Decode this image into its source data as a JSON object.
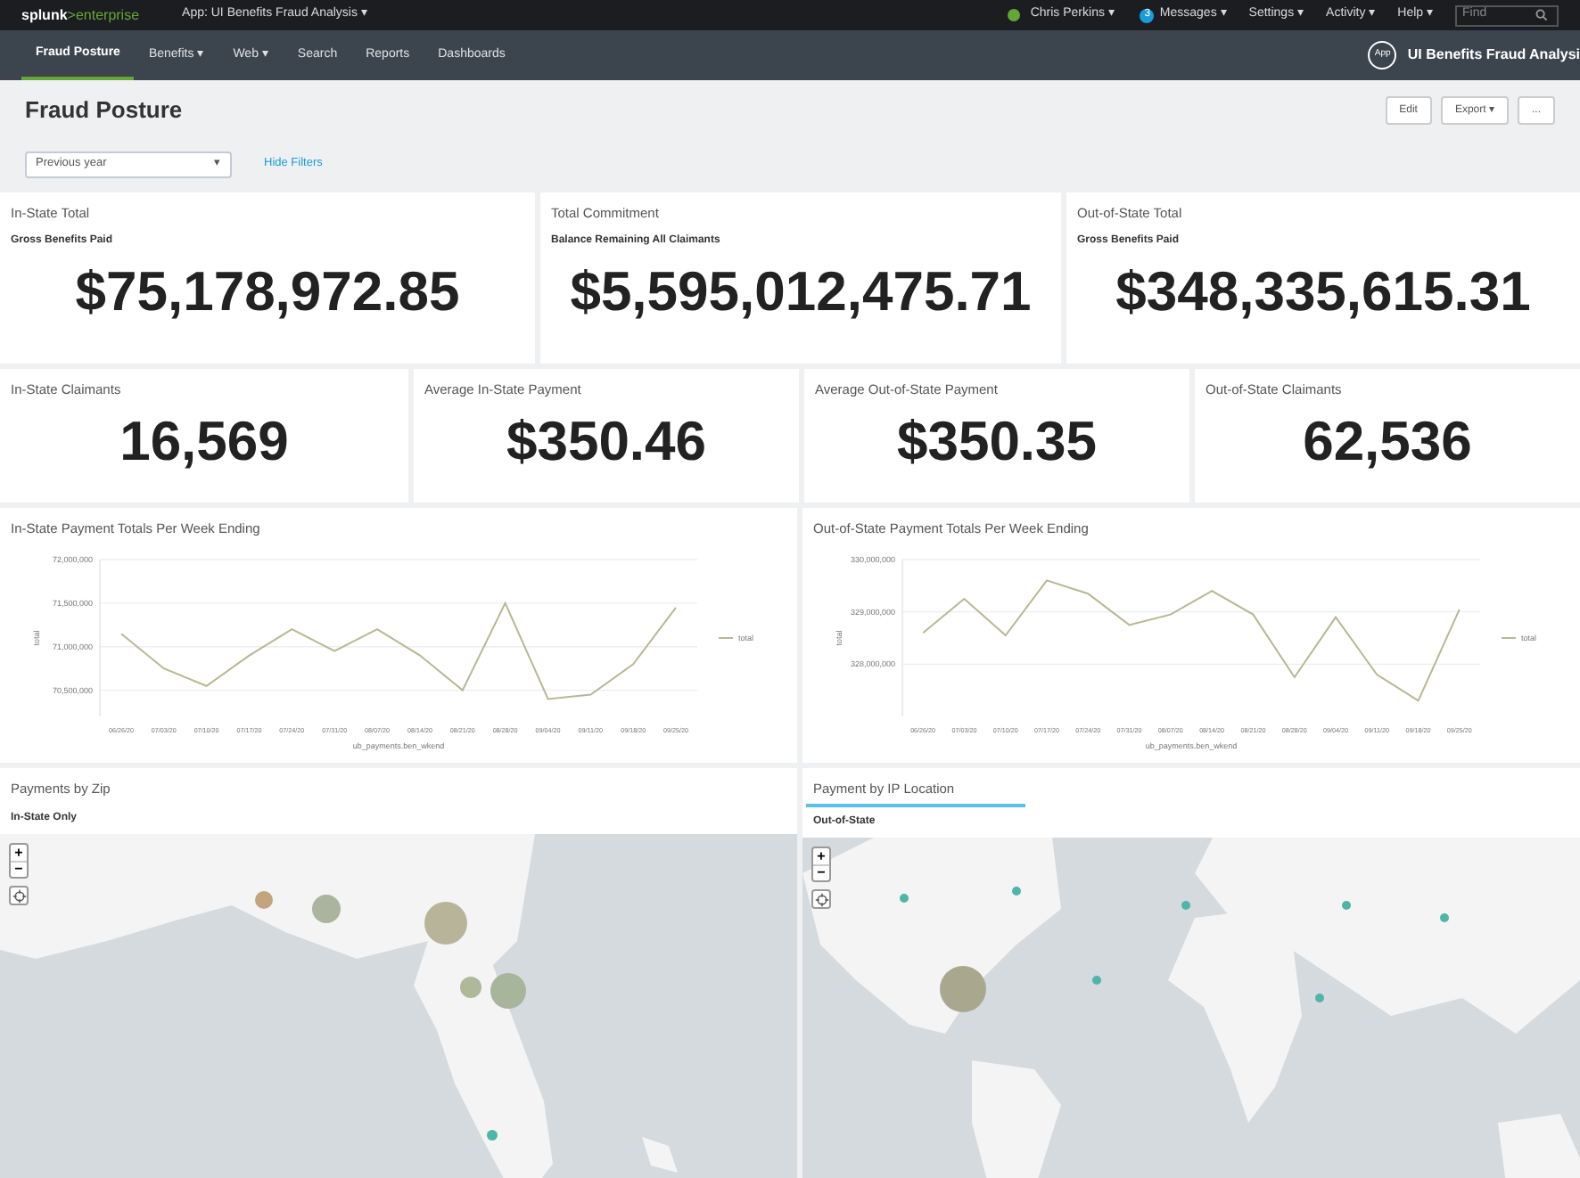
{
  "top_bar": {
    "logo": {
      "main": "splunk",
      "accent": ">enterprise"
    },
    "app_menu": "App: UI Benefits Fraud Analysis ▾",
    "user": "Chris Perkins ▾",
    "messages": {
      "count": "3",
      "label": "Messages ▾"
    },
    "menus": [
      "Settings ▾",
      "Activity ▾",
      "Help ▾"
    ],
    "find": {
      "placeholder": "Find"
    }
  },
  "nav": {
    "items": [
      {
        "label": "Fraud Posture",
        "selected": true
      },
      {
        "label": "Benefits ▾",
        "selected": false
      },
      {
        "label": "Web ▾",
        "selected": false
      },
      {
        "label": "Search",
        "selected": false
      },
      {
        "label": "Reports",
        "selected": false
      },
      {
        "label": "Dashboards",
        "selected": false
      }
    ],
    "app_badge": "App",
    "app_title": "UI Benefits Fraud Analysi"
  },
  "page": {
    "title": "Fraud Posture",
    "buttons": [
      "Edit",
      "Export ▾",
      "..."
    ]
  },
  "filters": {
    "time": {
      "value": "Previous year",
      "caret": "▾"
    },
    "hide_link": "Hide Filters"
  },
  "totals": [
    {
      "title": "In-State Total",
      "subtitle": "Gross Benefits Paid",
      "value": "$75,178,972.85"
    },
    {
      "title": "Total Commitment",
      "subtitle": "Balance Remaining All Claimants",
      "value": "$5,595,012,475.71"
    },
    {
      "title": "Out-of-State Total",
      "subtitle": "Gross Benefits Paid",
      "value": "$348,335,615.31"
    }
  ],
  "metrics": [
    {
      "title": "In-State Claimants",
      "value": "16,569"
    },
    {
      "title": "Average In-State Payment",
      "value": "$350.46"
    },
    {
      "title": "Average Out-of-State Payment",
      "value": "$350.35"
    },
    {
      "title": "Out-of-State Claimants",
      "value": "62,536"
    }
  ],
  "charts": [
    {
      "title": "In-State Payment Totals Per Week Ending",
      "chart_data": {
        "type": "line",
        "xlabel": "ub_payments.ben_wkend",
        "ylabel": "total",
        "categories": [
          "06/26/20",
          "07/03/20",
          "07/10/20",
          "07/17/20",
          "07/24/20",
          "07/31/20",
          "08/07/20",
          "08/14/20",
          "08/21/20",
          "08/28/20",
          "09/04/20",
          "09/11/20",
          "09/18/20",
          "09/25/20"
        ],
        "series": [
          {
            "name": "total",
            "color": "#b9b793",
            "values": [
              71150000,
              70750000,
              70550000,
              70900000,
              71200000,
              70950000,
              71200000,
              70900000,
              70500000,
              71500000,
              70400000,
              70450000,
              70800000,
              71450000
            ]
          }
        ],
        "grid": true,
        "ylim": [
          70200000,
          72000000
        ],
        "yticks": [
          {
            "value": 70500000,
            "label": "70,500,000"
          },
          {
            "value": 71000000,
            "label": "71,000,000"
          },
          {
            "value": 71500000,
            "label": "71,500,000"
          },
          {
            "value": 72000000,
            "label": "72,000,000"
          }
        ]
      }
    },
    {
      "title": "Out-of-State Payment Totals Per Week Ending",
      "chart_data": {
        "type": "line",
        "xlabel": "ub_payments.ben_wkend",
        "ylabel": "total",
        "categories": [
          "06/26/20",
          "07/03/20",
          "07/10/20",
          "07/17/20",
          "07/24/20",
          "07/31/20",
          "08/07/20",
          "08/14/20",
          "08/21/20",
          "08/28/20",
          "09/04/20",
          "09/11/20",
          "09/18/20",
          "09/25/20"
        ],
        "series": [
          {
            "name": "total",
            "color": "#b9b793",
            "values": [
              328600000,
              329250000,
              328550000,
              329600000,
              329350000,
              328750000,
              328950000,
              329400000,
              328950000,
              327750000,
              328900000,
              327800000,
              327300000,
              329050000
            ]
          }
        ],
        "grid": true,
        "ylim": [
          327000000,
          330000000
        ],
        "yticks": [
          {
            "value": 328000000,
            "label": "328,000,000"
          },
          {
            "value": 329000000,
            "label": "329,000,000"
          },
          {
            "value": 330000000,
            "label": "330,000,000"
          }
        ]
      }
    }
  ],
  "maps": [
    {
      "title": "Payments by Zip",
      "subtitle": "In-State Only",
      "highlighted": false,
      "zoom_in": "+",
      "zoom_out": "−",
      "kind": "picture"
    },
    {
      "title": "Payment by IP Location",
      "subtitle": "Out-of-State",
      "highlighted": true,
      "zoom_in": "+",
      "zoom_out": "−",
      "kind": "picture"
    }
  ]
}
